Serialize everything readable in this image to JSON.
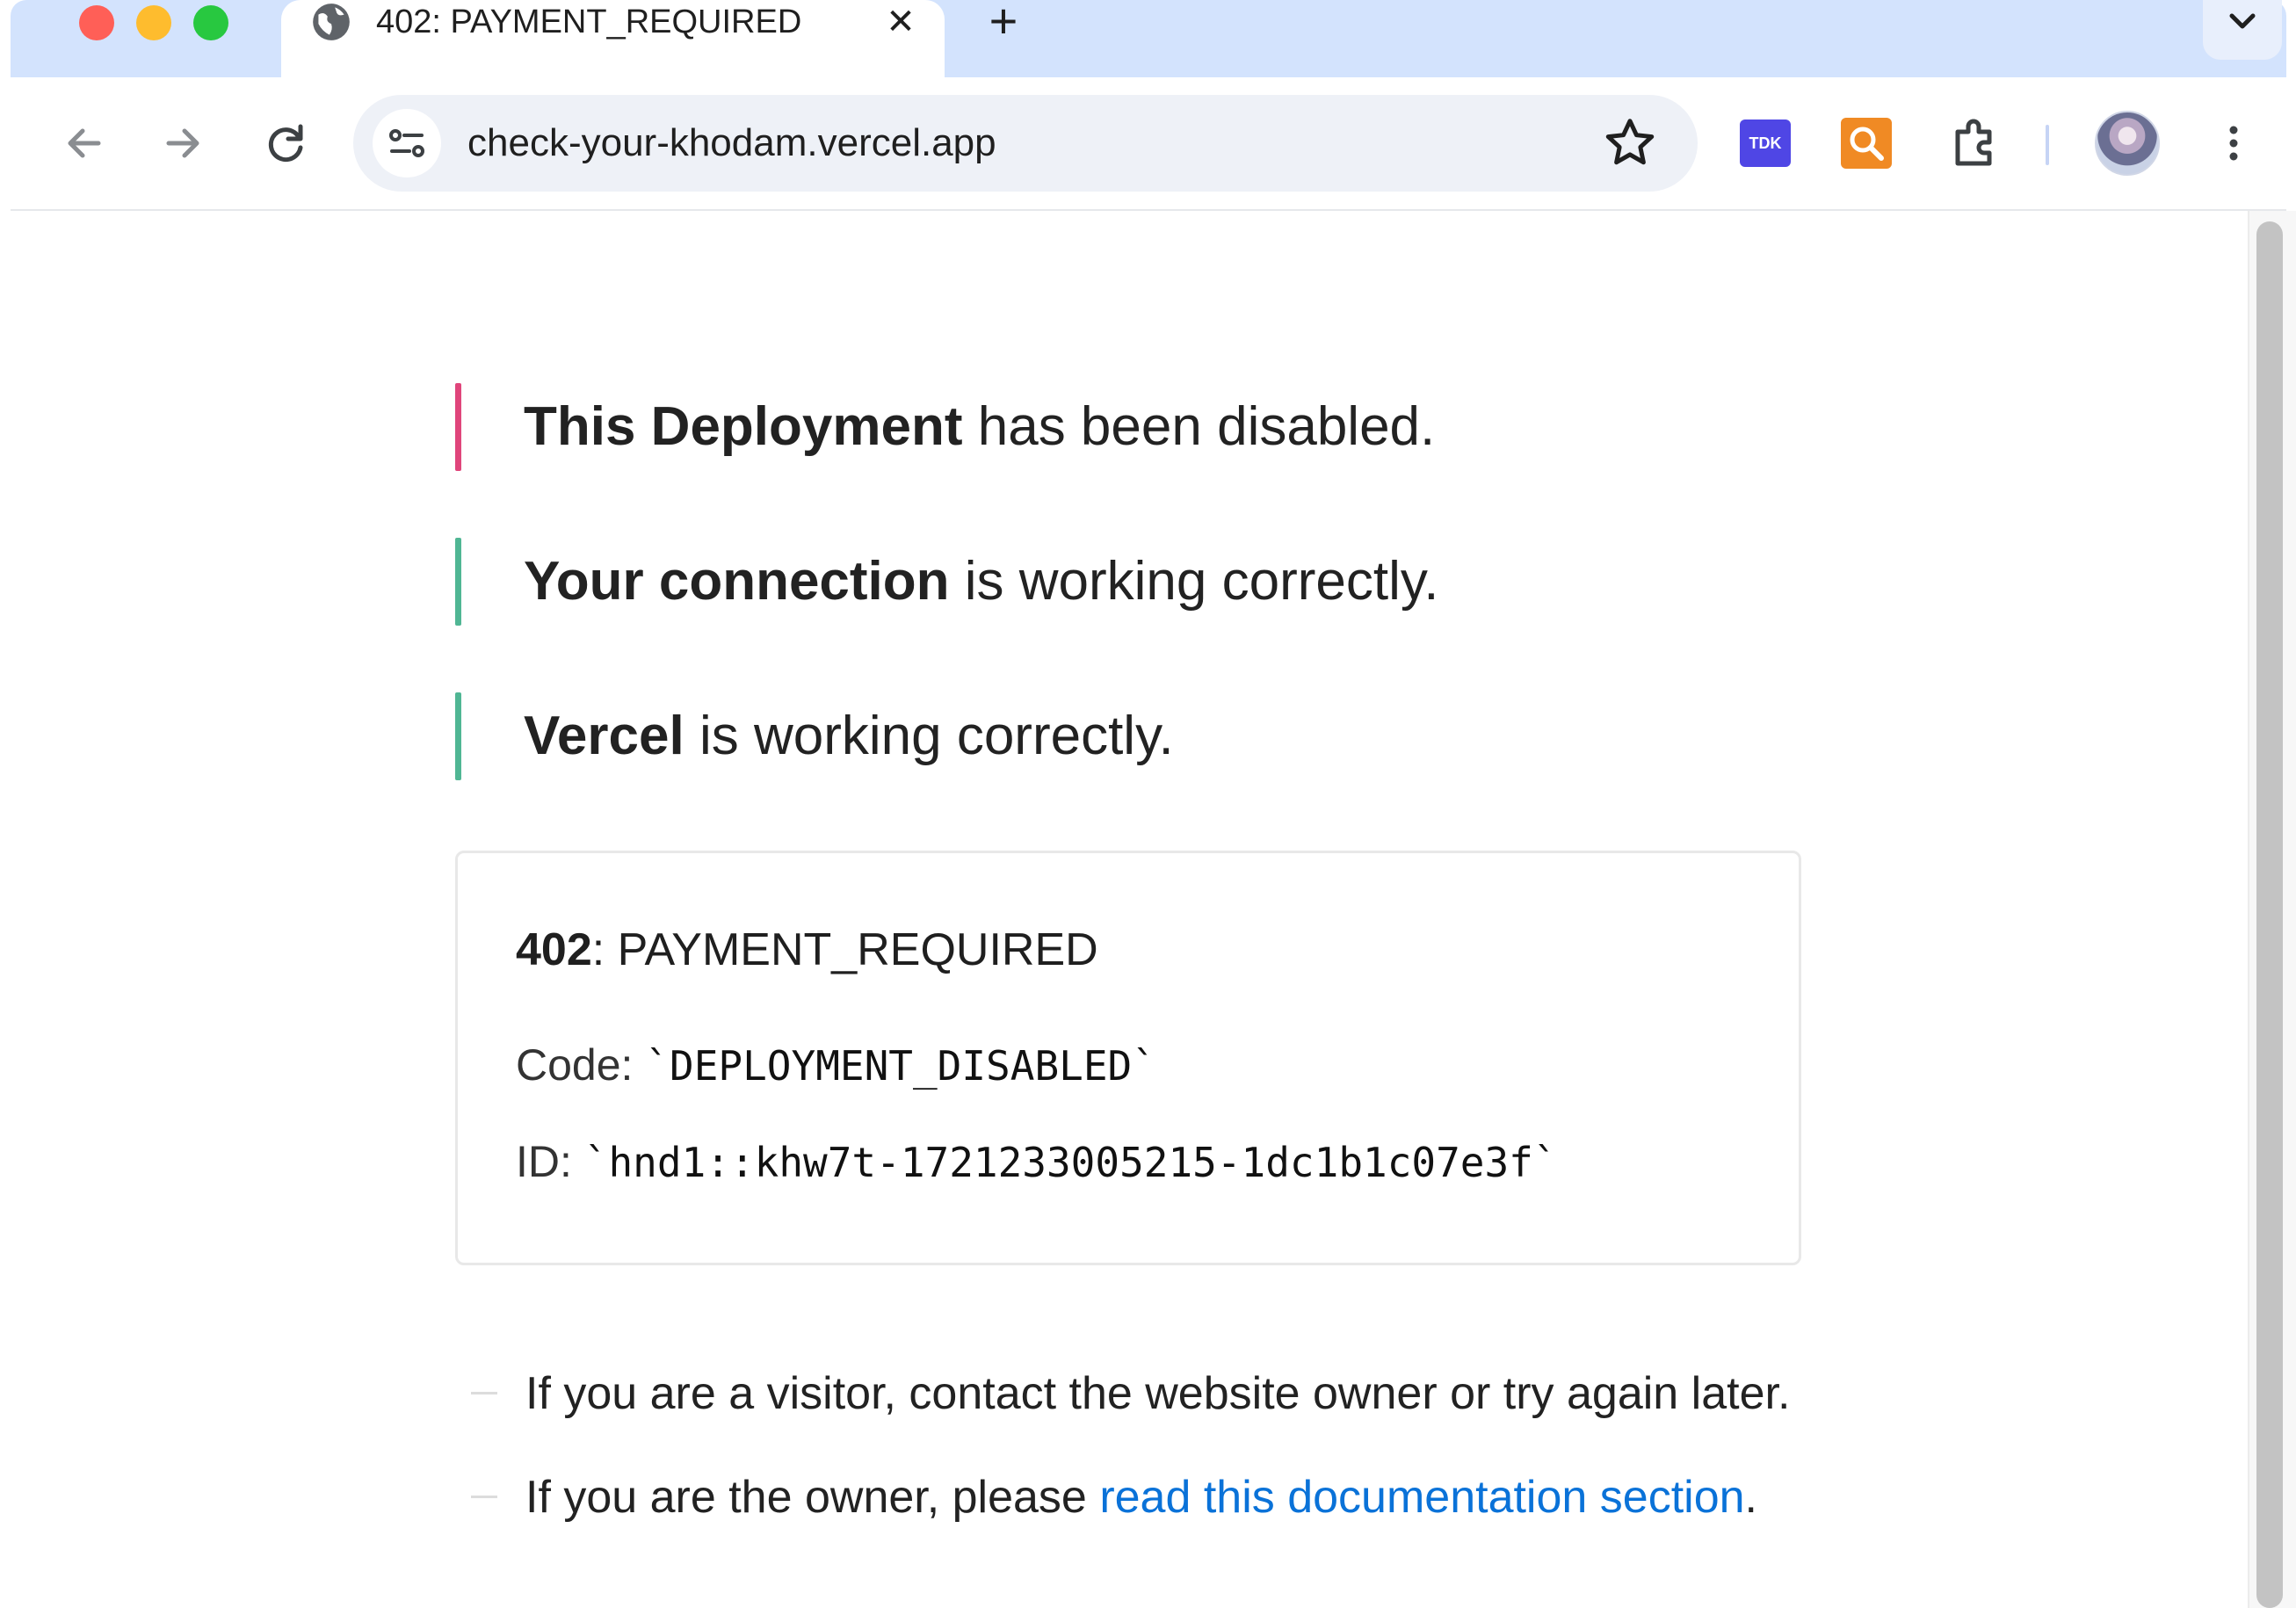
{
  "browser": {
    "tab": {
      "title": "402: PAYMENT_REQUIRED",
      "favicon": "globe-icon",
      "close_glyph": "✕"
    },
    "new_tab_glyph": "+",
    "address_bar": {
      "url": "check-your-khodam.vercel.app"
    },
    "extensions": [
      {
        "name": "TDK",
        "label": "TDK",
        "color": "#4f46e5"
      },
      {
        "name": "search-extension",
        "icon": "magnifier-icon",
        "color": "#f08a24"
      },
      {
        "name": "extensions",
        "icon": "puzzle-icon"
      }
    ]
  },
  "page": {
    "messages": [
      {
        "bold": "This Deployment",
        "rest": " has been disabled.",
        "bar_color": "#e0457b"
      },
      {
        "bold": "Your connection",
        "rest": " is working correctly.",
        "bar_color": "#50b694"
      },
      {
        "bold": "Vercel",
        "rest": " is working correctly.",
        "bar_color": "#50b694"
      }
    ],
    "error": {
      "status_code": "402",
      "status_text": ": PAYMENT_REQUIRED",
      "code_label": "Code: ",
      "code_value": "`DEPLOYMENT_DISABLED`",
      "id_label": "ID: ",
      "id_value": "`hnd1::khw7t-1721233005215-1dc1b1c07e3f`"
    },
    "hints": {
      "visitor": "If you are a visitor, contact the website owner or try again later.",
      "owner_prefix": "If you are the owner, please ",
      "owner_link": "read this documentation section",
      "owner_suffix": "."
    },
    "link_color": "#0a72d8"
  }
}
